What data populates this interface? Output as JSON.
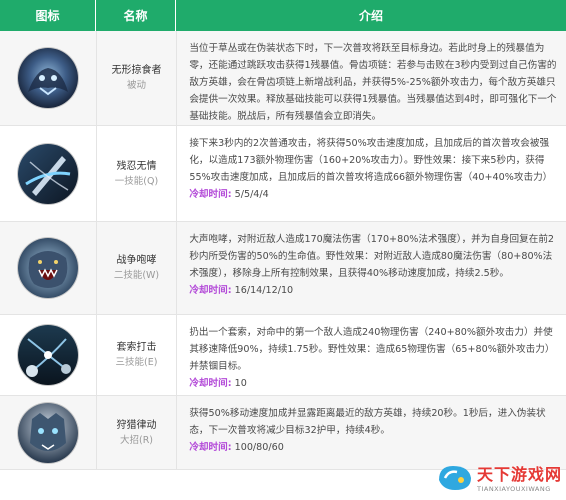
{
  "header": {
    "col_icon": "图标",
    "col_name": "名称",
    "col_desc": "介绍"
  },
  "cooldown_label": "冷却时间:",
  "skills": [
    {
      "icon": "shadow-wolf-icon",
      "name": "无形掠食者",
      "type": "被动",
      "desc": "当位于草丛或在伪装状态下时，下一次普攻将跃至目标身边。若此时身上的残暴值为零，还能通过跳跃攻击获得1残暴值。骨齿项链：若参与击败在3秒内受到过自己伤害的敌方英雄，会在骨齿项链上新增战利品，并获得5%-25%额外攻击力，每个敌方英雄只会提供一次效果。释放基础技能可以获得1残暴值。当残暴值达到4时，即可强化下一个基础技能。脱战后，所有残暴值会立即消失。",
      "cooldown": ""
    },
    {
      "icon": "blade-slash-icon",
      "name": "残忍无情",
      "type": "一技能(Q)",
      "desc": "接下来3秒内的2次普通攻击，将获得50%攻击速度加成，且加成后的首次普攻会被强化，以造成173额外物理伤害（160+20%攻击力）。野性效果：接下来5秒内，获得55%攻击速度加成，且加成后的首次普攻将造成66额外物理伤害（40+40%攻击力）",
      "cooldown": "5/5/4/4"
    },
    {
      "icon": "roaring-beast-icon",
      "name": "战争咆哮",
      "type": "二技能(W)",
      "desc": "大声咆哮，对附近敌人造成170魔法伤害（170+80%法术强度），并为自身回复在前2秒内所受伤害的50%的生命值。野性效果：对附近敌人造成80魔法伤害（80+80%法术强度），移除身上所有控制效果，且获得40%移动速度加成，持续2.5秒。",
      "cooldown": "16/14/12/10"
    },
    {
      "icon": "bola-throw-icon",
      "name": "套索打击",
      "type": "三技能(E)",
      "desc": "扔出一个套索，对命中的第一个敌人造成240物理伤害（240+80%额外攻击力）并使其移速降低90%，持续1.75秒。野性效果：造成65物理伤害（65+80%额外攻击力）并禁锢目标。",
      "cooldown": "10"
    },
    {
      "icon": "hunter-face-icon",
      "name": "狩猎律动",
      "type": "大招(R)",
      "desc": "获得50%移动速度加成并显露距离最近的敌方英雄，持续20秒。1秒后，进入伪装状态，下一次普攻将减少目标32护甲，持续4秒。",
      "cooldown": "100/80/60"
    }
  ],
  "watermark": {
    "title": "天下游戏网",
    "subtitle": "TIANXIAYOUXIWANG"
  },
  "colors": {
    "header_bg": "#1fab6b",
    "cooldown_label": "#b34ad8",
    "watermark": "#e53935"
  }
}
